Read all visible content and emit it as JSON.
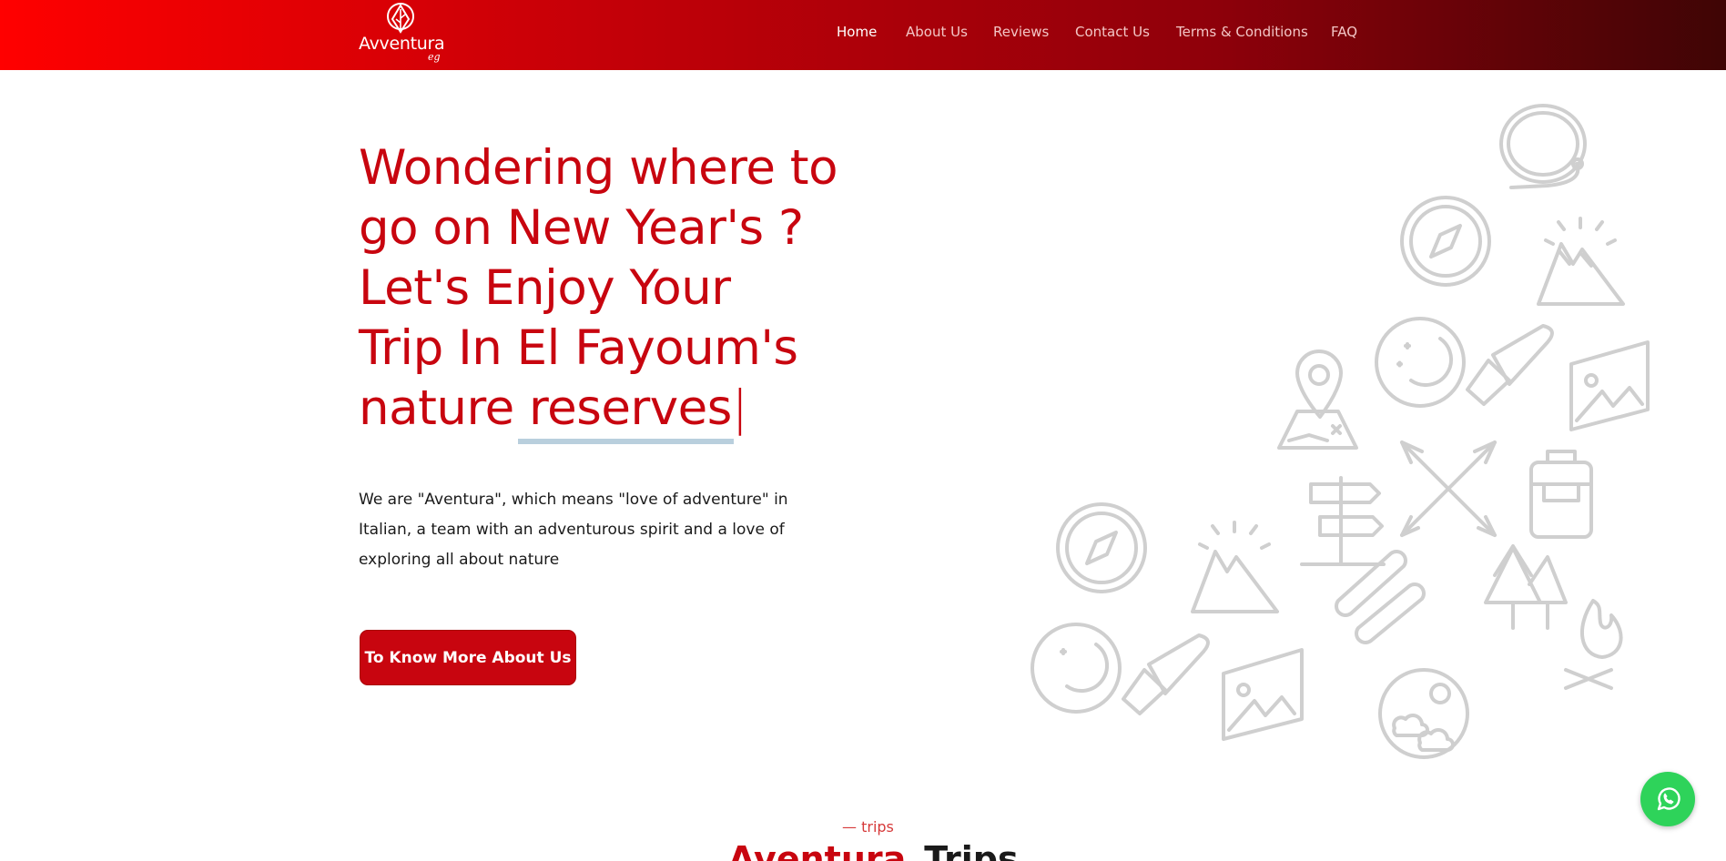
{
  "header": {
    "logo": {
      "name": "Avventura",
      "sub": "eg"
    },
    "nav": [
      {
        "label": "Home",
        "active": true
      },
      {
        "label": "About Us",
        "active": false
      },
      {
        "label": "Reviews",
        "active": false
      },
      {
        "label": "Contact Us",
        "active": false
      },
      {
        "label": "Terms & Conditions",
        "active": false
      },
      {
        "label": "FAQ",
        "active": false
      }
    ]
  },
  "hero": {
    "title_lines": [
      "Wondering where to",
      "go on New Year's ?",
      "Let's Enjoy Your",
      "Trip In El Fayoum's",
      "nature"
    ],
    "title_typed": "reserves",
    "cursor": "|",
    "description": "We are \"Aventura\", which means \"love of adventure\" in Italian, a team with an adventurous spirit and a love of exploring all about nature",
    "cta_label": "To Know More About Us"
  },
  "trips_section": {
    "subtitle": "— trips",
    "title_a": "Aventura",
    "title_b": "Trips"
  },
  "colors": {
    "accent": "#c8050f",
    "header_gradient_start": "#ff0000",
    "header_gradient_end": "#3f0505",
    "whatsapp": "#2ed35a",
    "illustration_stroke": "#cfcfcf"
  },
  "icons": {
    "whatsapp": "whatsapp-icon",
    "logo": "leaf-logo-icon"
  }
}
